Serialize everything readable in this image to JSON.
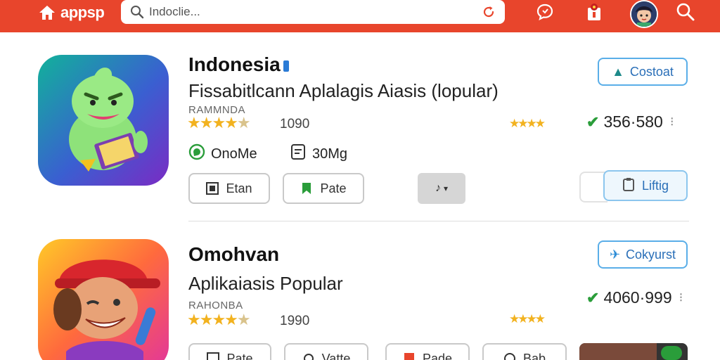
{
  "header": {
    "brand": "appsp",
    "search_value": "Indoclie...",
    "icons": [
      "home-icon",
      "search-icon",
      "refresh-icon",
      "chat-icon",
      "notification-icon",
      "avatar",
      "search-icon"
    ],
    "accent_color": "#e8452c"
  },
  "apps": [
    {
      "title": "Indonesia",
      "subtitle": "Fissabitlcann Aplalagis Aiasis (lopular)",
      "developer": "RAMMNDA",
      "rating_count": "1090",
      "price": "356·580",
      "contact_label": "Costoat",
      "meta1": "OnoMe",
      "meta2": "30Mg",
      "btn1": "Etan",
      "btn2": "Pate",
      "listing_label": "Liftig"
    },
    {
      "title": "Omohvan",
      "subtitle": "Aplikaiasis Popular",
      "developer": "RAHONBA",
      "rating_count": "1990",
      "price": "4060·999",
      "contact_label": "Cokyurst",
      "btn1": "Pate",
      "btn2": "Vatte",
      "btn3": "Pade",
      "btn4": "Bab"
    }
  ]
}
